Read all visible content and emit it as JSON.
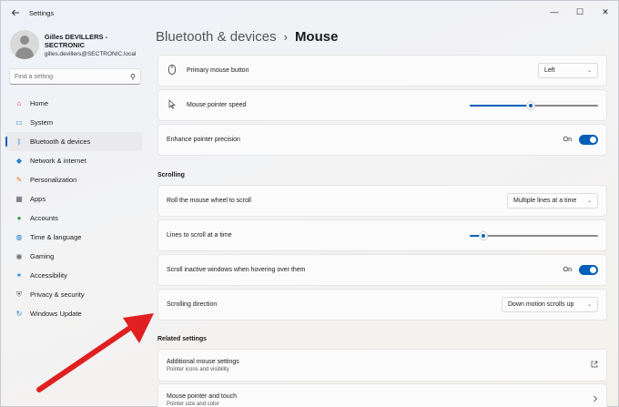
{
  "titlebar": {
    "app_title": "Settings",
    "back_icon": "back-arrow-icon",
    "minimize_glyph": "—",
    "maximize_glyph": "☐",
    "close_glyph": "✕"
  },
  "profile": {
    "name": "Gilles DEVILLERS - SECTRONIC",
    "email": "gilles.devillers@SECTRONIC.local"
  },
  "search": {
    "placeholder": "Find a setting"
  },
  "sidebar": {
    "items": [
      {
        "label": "Home",
        "icon": "home-icon",
        "color": "#d14a2c"
      },
      {
        "label": "System",
        "icon": "system-icon",
        "color": "#1a7fd4"
      },
      {
        "label": "Bluetooth & devices",
        "icon": "bluetooth-icon",
        "color": "#1a7fd4"
      },
      {
        "label": "Network & internet",
        "icon": "network-icon",
        "color": "#1a7fd4"
      },
      {
        "label": "Personalization",
        "icon": "brush-icon",
        "color": "#e07b2e"
      },
      {
        "label": "Apps",
        "icon": "apps-icon",
        "color": "#555b66"
      },
      {
        "label": "Accounts",
        "icon": "accounts-icon",
        "color": "#2e9d5a"
      },
      {
        "label": "Time & language",
        "icon": "globe-icon",
        "color": "#1a7fd4"
      },
      {
        "label": "Gaming",
        "icon": "gaming-icon",
        "color": "#6b6b6b"
      },
      {
        "label": "Accessibility",
        "icon": "accessibility-icon",
        "color": "#1a7fd4"
      },
      {
        "label": "Privacy & security",
        "icon": "shield-icon",
        "color": "#6b6b6b"
      },
      {
        "label": "Windows Update",
        "icon": "update-icon",
        "color": "#1a7fd4"
      }
    ],
    "active_index": 2
  },
  "breadcrumb": {
    "parent": "Bluetooth & devices",
    "separator": "›",
    "current": "Mouse"
  },
  "settings": {
    "primary_button": {
      "label": "Primary mouse button",
      "value": "Left"
    },
    "pointer_speed": {
      "label": "Mouse pointer speed",
      "level": 0.47
    },
    "enhance_precision": {
      "label": "Enhance pointer precision",
      "state": "On"
    },
    "scrolling_title": "Scrolling",
    "roll_wheel": {
      "label": "Roll the mouse wheel to scroll",
      "value": "Multiple lines at a time"
    },
    "lines_to_scroll": {
      "label": "Lines to scroll at a time",
      "level": 0.08
    },
    "scroll_inactive": {
      "label": "Scroll inactive windows when hovering over them",
      "state": "On"
    },
    "scroll_direction": {
      "label": "Scrolling direction",
      "value": "Down motion scrolls up"
    },
    "related_title": "Related settings",
    "additional": {
      "label": "Additional mouse settings",
      "sub": "Pointer icons and visibility"
    },
    "pointer_touch": {
      "label": "Mouse pointer and touch",
      "sub": "Pointer size and color"
    }
  },
  "colors": {
    "accent": "#005fb8",
    "annotation_arrow": "#e02020"
  }
}
